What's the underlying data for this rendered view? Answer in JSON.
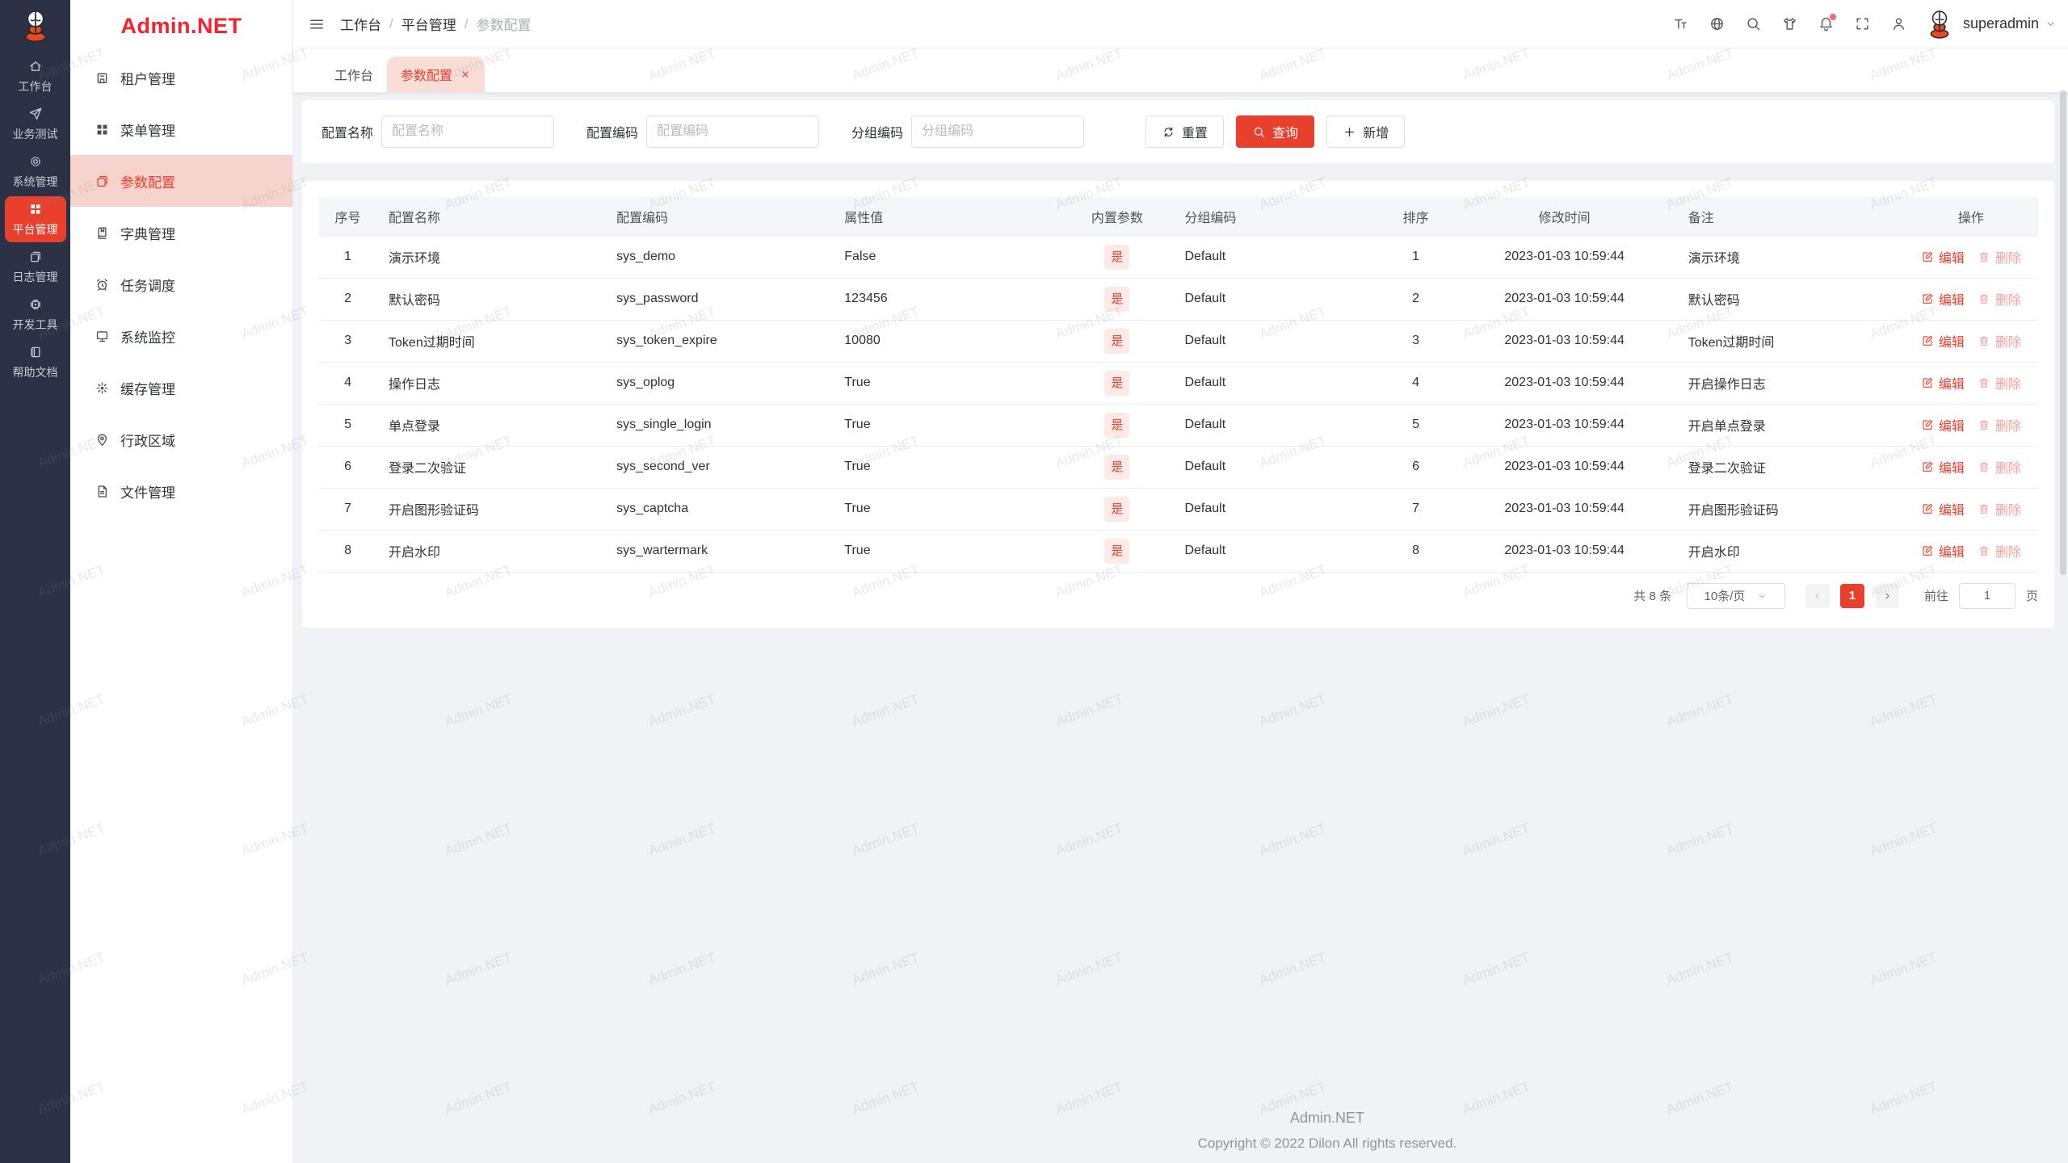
{
  "colors": {
    "accent": "#e8402d",
    "logo_red": "#f5222d",
    "rail_bg": "#2b3245",
    "menu_active_bg": "#f6d3cd",
    "tab_active_bg": "#fbddd8",
    "badge_bg": "#fdeae7",
    "badge_text": "#e8402d",
    "delete_link": "#f8a09a",
    "content_bg": "#f0f2f5"
  },
  "watermark": {
    "text": "Admin.NET"
  },
  "rail": {
    "items": [
      {
        "label": "工作台",
        "icon": "home-icon",
        "active": false
      },
      {
        "label": "业务测试",
        "icon": "send-icon",
        "active": false
      },
      {
        "label": "系统管理",
        "icon": "gear-icon",
        "active": false
      },
      {
        "label": "平台管理",
        "icon": "grid-icon",
        "active": true
      },
      {
        "label": "日志管理",
        "icon": "copy-icon",
        "active": false
      },
      {
        "label": "开发工具",
        "icon": "chip-icon",
        "active": false
      },
      {
        "label": "帮助文档",
        "icon": "notebook-icon",
        "active": false
      }
    ]
  },
  "sidebar": {
    "logo_text": "Admin.NET",
    "items": [
      {
        "label": "租户管理",
        "icon": "building-icon",
        "active": false
      },
      {
        "label": "菜单管理",
        "icon": "grid-icon",
        "active": false
      },
      {
        "label": "参数配置",
        "icon": "copy-icon",
        "active": true
      },
      {
        "label": "字典管理",
        "icon": "book-icon",
        "active": false
      },
      {
        "label": "任务调度",
        "icon": "alarm-icon",
        "active": false
      },
      {
        "label": "系统监控",
        "icon": "monitor-icon",
        "active": false
      },
      {
        "label": "缓存管理",
        "icon": "snowflake-icon",
        "active": false
      },
      {
        "label": "行政区域",
        "icon": "pin-icon",
        "active": false
      },
      {
        "label": "文件管理",
        "icon": "doc-icon",
        "active": false
      }
    ]
  },
  "topbar": {
    "breadcrumb": [
      "工作台",
      "平台管理",
      "参数配置"
    ],
    "icons": [
      {
        "name": "fontsize-icon",
        "badge": false
      },
      {
        "name": "globe-icon",
        "badge": false
      },
      {
        "name": "search-icon",
        "badge": false
      },
      {
        "name": "shirt-icon",
        "badge": false
      },
      {
        "name": "bell-icon",
        "badge": true
      },
      {
        "name": "fullscreen-icon",
        "badge": false
      },
      {
        "name": "person-icon",
        "badge": false
      }
    ],
    "username": "superadmin"
  },
  "tabs": [
    {
      "label": "工作台",
      "active": false,
      "closable": false
    },
    {
      "label": "参数配置",
      "active": true,
      "closable": true
    }
  ],
  "filters": {
    "fields": [
      {
        "label": "配置名称",
        "placeholder": "配置名称",
        "value": ""
      },
      {
        "label": "配置编码",
        "placeholder": "配置编码",
        "value": ""
      },
      {
        "label": "分组编码",
        "placeholder": "分组编码",
        "value": ""
      }
    ],
    "reset_label": "重置",
    "query_label": "查询",
    "add_label": "新增"
  },
  "table": {
    "columns": [
      "序号",
      "配置名称",
      "配置编码",
      "属性值",
      "内置参数",
      "分组编码",
      "排序",
      "修改时间",
      "备注",
      "操作"
    ],
    "edit_label": "编辑",
    "delete_label": "删除",
    "rows": [
      {
        "index": "1",
        "name": "演示环境",
        "code": "sys_demo",
        "value": "False",
        "builtin": "是",
        "group": "Default",
        "sort": "1",
        "time": "2023-01-03 10:59:44",
        "remark": "演示环境"
      },
      {
        "index": "2",
        "name": "默认密码",
        "code": "sys_password",
        "value": "123456",
        "builtin": "是",
        "group": "Default",
        "sort": "2",
        "time": "2023-01-03 10:59:44",
        "remark": "默认密码"
      },
      {
        "index": "3",
        "name": "Token过期时间",
        "code": "sys_token_expire",
        "value": "10080",
        "builtin": "是",
        "group": "Default",
        "sort": "3",
        "time": "2023-01-03 10:59:44",
        "remark": "Token过期时间"
      },
      {
        "index": "4",
        "name": "操作日志",
        "code": "sys_oplog",
        "value": "True",
        "builtin": "是",
        "group": "Default",
        "sort": "4",
        "time": "2023-01-03 10:59:44",
        "remark": "开启操作日志"
      },
      {
        "index": "5",
        "name": "单点登录",
        "code": "sys_single_login",
        "value": "True",
        "builtin": "是",
        "group": "Default",
        "sort": "5",
        "time": "2023-01-03 10:59:44",
        "remark": "开启单点登录"
      },
      {
        "index": "6",
        "name": "登录二次验证",
        "code": "sys_second_ver",
        "value": "True",
        "builtin": "是",
        "group": "Default",
        "sort": "6",
        "time": "2023-01-03 10:59:44",
        "remark": "登录二次验证"
      },
      {
        "index": "7",
        "name": "开启图形验证码",
        "code": "sys_captcha",
        "value": "True",
        "builtin": "是",
        "group": "Default",
        "sort": "7",
        "time": "2023-01-03 10:59:44",
        "remark": "开启图形验证码"
      },
      {
        "index": "8",
        "name": "开启水印",
        "code": "sys_wartermark",
        "value": "True",
        "builtin": "是",
        "group": "Default",
        "sort": "8",
        "time": "2023-01-03 10:59:44",
        "remark": "开启水印"
      }
    ]
  },
  "pagination": {
    "total": "共 8 条",
    "page_size": "10条/页",
    "current": "1",
    "goto_label": "前往",
    "goto_value": "1",
    "goto_suffix": "页"
  },
  "footer": {
    "title": "Admin.NET",
    "copyright": "Copyright © 2022 Dilon All rights reserved."
  }
}
